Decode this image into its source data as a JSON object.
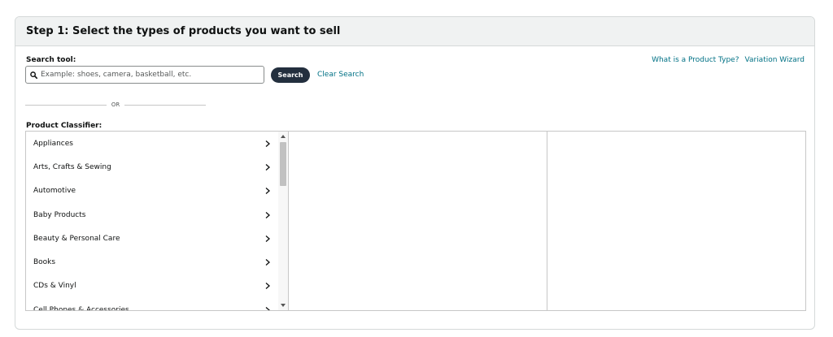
{
  "header": {
    "title": "Step 1: Select the types of products you want to sell"
  },
  "search": {
    "label": "Search tool:",
    "placeholder": "Example: shoes, camera, basketball, etc.",
    "value": "",
    "button_label": "Search",
    "clear_label": "Clear Search"
  },
  "links": {
    "product_type": "What is a Product Type?",
    "variation_wizard": "Variation Wizard"
  },
  "divider": {
    "text": "OR"
  },
  "classifier": {
    "label": "Product Classifier:",
    "categories": [
      {
        "label": "Appliances"
      },
      {
        "label": "Arts, Crafts & Sewing"
      },
      {
        "label": "Automotive"
      },
      {
        "label": "Baby Products"
      },
      {
        "label": "Beauty & Personal Care"
      },
      {
        "label": "Books"
      },
      {
        "label": "CDs & Vinyl"
      },
      {
        "label": "Cell Phones & Accessories"
      }
    ]
  },
  "colors": {
    "link": "#007185",
    "button_bg": "#232f3e",
    "header_bg": "#f0f2f2",
    "border": "#d5d9d9"
  },
  "icons": {
    "search": "search-icon",
    "chevron": "chevron-right-icon"
  }
}
